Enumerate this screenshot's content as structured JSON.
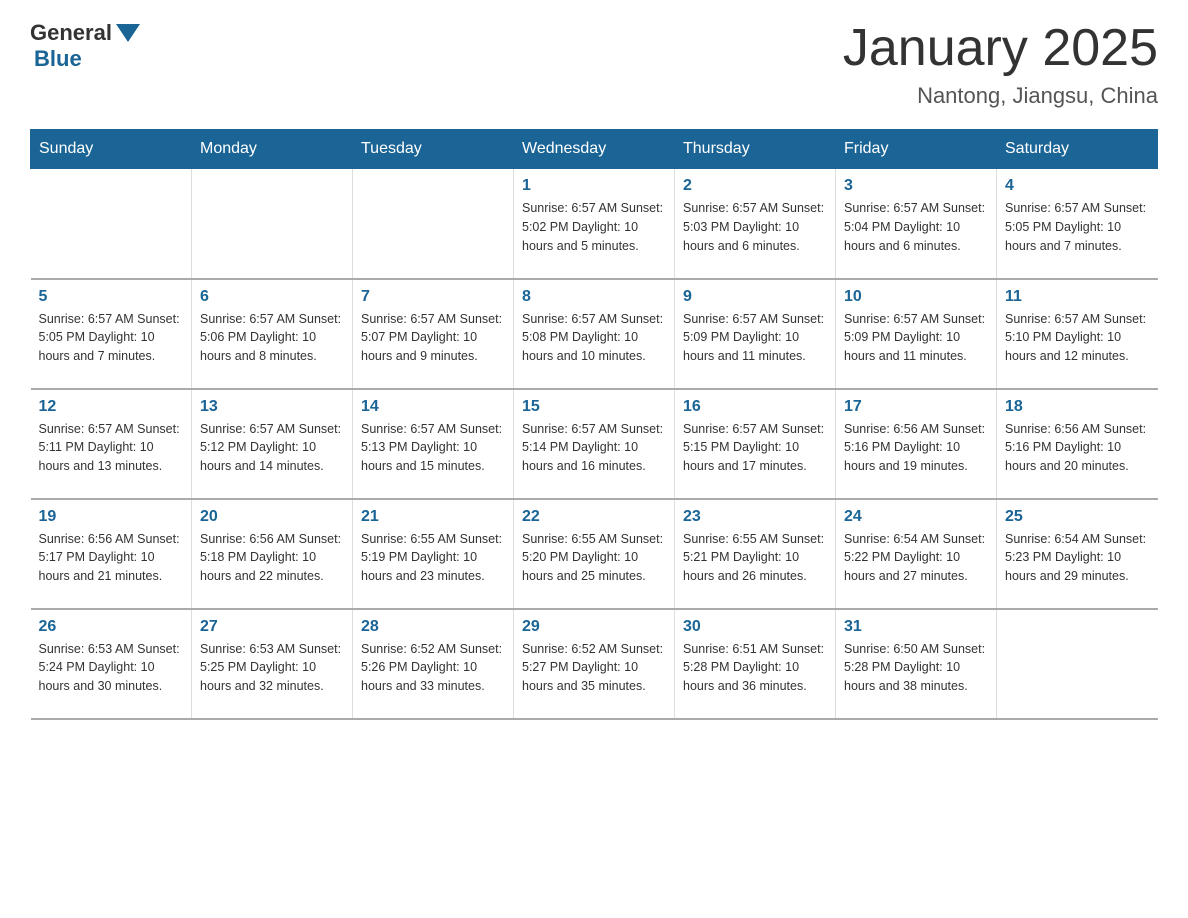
{
  "logo": {
    "general": "General",
    "blue": "Blue"
  },
  "title": "January 2025",
  "subtitle": "Nantong, Jiangsu, China",
  "days_of_week": [
    "Sunday",
    "Monday",
    "Tuesday",
    "Wednesday",
    "Thursday",
    "Friday",
    "Saturday"
  ],
  "weeks": [
    [
      {
        "day": "",
        "info": ""
      },
      {
        "day": "",
        "info": ""
      },
      {
        "day": "",
        "info": ""
      },
      {
        "day": "1",
        "info": "Sunrise: 6:57 AM\nSunset: 5:02 PM\nDaylight: 10 hours and 5 minutes."
      },
      {
        "day": "2",
        "info": "Sunrise: 6:57 AM\nSunset: 5:03 PM\nDaylight: 10 hours and 6 minutes."
      },
      {
        "day": "3",
        "info": "Sunrise: 6:57 AM\nSunset: 5:04 PM\nDaylight: 10 hours and 6 minutes."
      },
      {
        "day": "4",
        "info": "Sunrise: 6:57 AM\nSunset: 5:05 PM\nDaylight: 10 hours and 7 minutes."
      }
    ],
    [
      {
        "day": "5",
        "info": "Sunrise: 6:57 AM\nSunset: 5:05 PM\nDaylight: 10 hours and 7 minutes."
      },
      {
        "day": "6",
        "info": "Sunrise: 6:57 AM\nSunset: 5:06 PM\nDaylight: 10 hours and 8 minutes."
      },
      {
        "day": "7",
        "info": "Sunrise: 6:57 AM\nSunset: 5:07 PM\nDaylight: 10 hours and 9 minutes."
      },
      {
        "day": "8",
        "info": "Sunrise: 6:57 AM\nSunset: 5:08 PM\nDaylight: 10 hours and 10 minutes."
      },
      {
        "day": "9",
        "info": "Sunrise: 6:57 AM\nSunset: 5:09 PM\nDaylight: 10 hours and 11 minutes."
      },
      {
        "day": "10",
        "info": "Sunrise: 6:57 AM\nSunset: 5:09 PM\nDaylight: 10 hours and 11 minutes."
      },
      {
        "day": "11",
        "info": "Sunrise: 6:57 AM\nSunset: 5:10 PM\nDaylight: 10 hours and 12 minutes."
      }
    ],
    [
      {
        "day": "12",
        "info": "Sunrise: 6:57 AM\nSunset: 5:11 PM\nDaylight: 10 hours and 13 minutes."
      },
      {
        "day": "13",
        "info": "Sunrise: 6:57 AM\nSunset: 5:12 PM\nDaylight: 10 hours and 14 minutes."
      },
      {
        "day": "14",
        "info": "Sunrise: 6:57 AM\nSunset: 5:13 PM\nDaylight: 10 hours and 15 minutes."
      },
      {
        "day": "15",
        "info": "Sunrise: 6:57 AM\nSunset: 5:14 PM\nDaylight: 10 hours and 16 minutes."
      },
      {
        "day": "16",
        "info": "Sunrise: 6:57 AM\nSunset: 5:15 PM\nDaylight: 10 hours and 17 minutes."
      },
      {
        "day": "17",
        "info": "Sunrise: 6:56 AM\nSunset: 5:16 PM\nDaylight: 10 hours and 19 minutes."
      },
      {
        "day": "18",
        "info": "Sunrise: 6:56 AM\nSunset: 5:16 PM\nDaylight: 10 hours and 20 minutes."
      }
    ],
    [
      {
        "day": "19",
        "info": "Sunrise: 6:56 AM\nSunset: 5:17 PM\nDaylight: 10 hours and 21 minutes."
      },
      {
        "day": "20",
        "info": "Sunrise: 6:56 AM\nSunset: 5:18 PM\nDaylight: 10 hours and 22 minutes."
      },
      {
        "day": "21",
        "info": "Sunrise: 6:55 AM\nSunset: 5:19 PM\nDaylight: 10 hours and 23 minutes."
      },
      {
        "day": "22",
        "info": "Sunrise: 6:55 AM\nSunset: 5:20 PM\nDaylight: 10 hours and 25 minutes."
      },
      {
        "day": "23",
        "info": "Sunrise: 6:55 AM\nSunset: 5:21 PM\nDaylight: 10 hours and 26 minutes."
      },
      {
        "day": "24",
        "info": "Sunrise: 6:54 AM\nSunset: 5:22 PM\nDaylight: 10 hours and 27 minutes."
      },
      {
        "day": "25",
        "info": "Sunrise: 6:54 AM\nSunset: 5:23 PM\nDaylight: 10 hours and 29 minutes."
      }
    ],
    [
      {
        "day": "26",
        "info": "Sunrise: 6:53 AM\nSunset: 5:24 PM\nDaylight: 10 hours and 30 minutes."
      },
      {
        "day": "27",
        "info": "Sunrise: 6:53 AM\nSunset: 5:25 PM\nDaylight: 10 hours and 32 minutes."
      },
      {
        "day": "28",
        "info": "Sunrise: 6:52 AM\nSunset: 5:26 PM\nDaylight: 10 hours and 33 minutes."
      },
      {
        "day": "29",
        "info": "Sunrise: 6:52 AM\nSunset: 5:27 PM\nDaylight: 10 hours and 35 minutes."
      },
      {
        "day": "30",
        "info": "Sunrise: 6:51 AM\nSunset: 5:28 PM\nDaylight: 10 hours and 36 minutes."
      },
      {
        "day": "31",
        "info": "Sunrise: 6:50 AM\nSunset: 5:28 PM\nDaylight: 10 hours and 38 minutes."
      },
      {
        "day": "",
        "info": ""
      }
    ]
  ]
}
